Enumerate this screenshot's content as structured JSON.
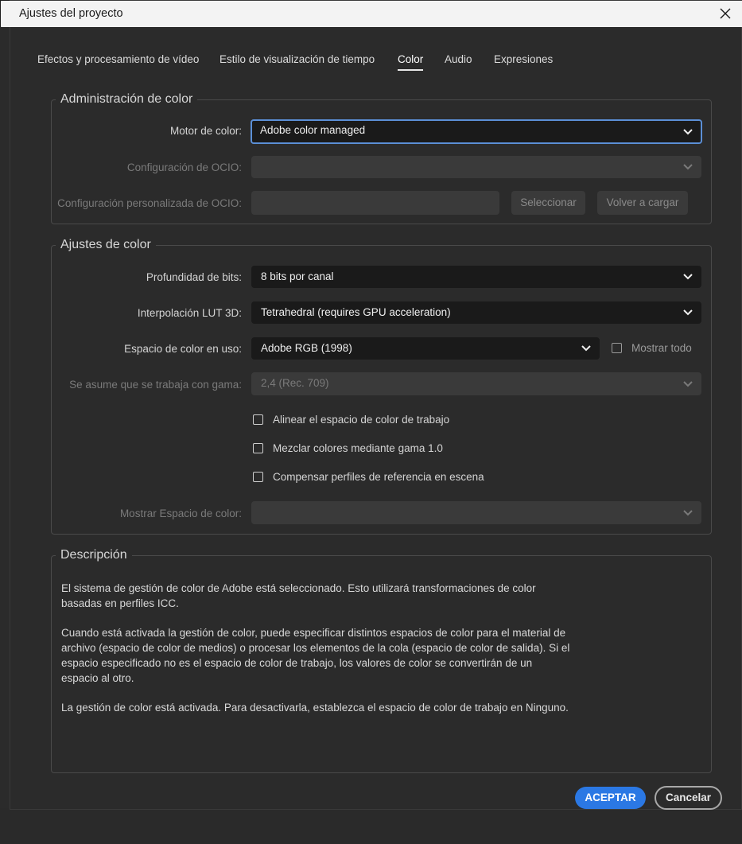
{
  "window": {
    "title": "Ajustes del proyecto",
    "close_icon": "close-icon"
  },
  "tabs": [
    {
      "label": "Efectos y procesamiento de vídeo",
      "active": false
    },
    {
      "label": "Estilo de visualización de tiempo",
      "active": false
    },
    {
      "label": "Color",
      "active": true
    },
    {
      "label": "Audio",
      "active": false
    },
    {
      "label": "Expresiones",
      "active": false
    }
  ],
  "color_management": {
    "legend": "Administración de color",
    "engine_label": "Motor de color:",
    "engine_value": "Adobe color managed",
    "ocio_config_label": "Configuración de OCIO:",
    "ocio_config_value": "",
    "ocio_custom_label": "Configuración personalizada de OCIO:",
    "select_button": "Seleccionar",
    "reload_button": "Volver a cargar"
  },
  "color_settings": {
    "legend": "Ajustes de color",
    "bit_depth_label": "Profundidad de bits:",
    "bit_depth_value": "8 bits por canal",
    "lut_label": "Interpolación LUT 3D:",
    "lut_value": "Tetrahedral (requires GPU acceleration)",
    "working_space_label": "Espacio de color en uso:",
    "working_space_value": "Adobe RGB (1998)",
    "show_all_label": "Mostrar todo",
    "gamma_label": "Se asume que se trabaja con gama:",
    "gamma_value": "2,4 (Rec. 709)",
    "align_label": "Alinear el espacio de color de trabajo",
    "blend_label": "Mezclar colores mediante gama 1.0",
    "compensate_label": "Compensar perfiles de referencia en escena",
    "display_space_label": "Mostrar Espacio de color:",
    "display_space_value": ""
  },
  "description": {
    "legend": "Descripción",
    "p1": "El sistema de gestión de color de Adobe está seleccionado. Esto utilizará transformaciones de color basadas en perfiles ICC.",
    "p2": "Cuando está activada la gestión de color, puede especificar distintos espacios de color para el material de archivo (espacio de color de medios) o procesar los elementos de la cola (espacio de color de salida). Si el espacio especificado no es el espacio de color de trabajo, los valores de color se convertirán de un espacio al otro.",
    "p3": "La gestión de color está activada. Para desactivarla, establezca el espacio de color de trabajo en Ninguno."
  },
  "footer": {
    "ok_button": "ACEPTAR",
    "cancel_button": "Cancelar"
  },
  "colors": {
    "accent": "#2b78e4",
    "focus_ring": "#5b8fd6",
    "dialog_bg": "#2b2b2b",
    "field_bg": "#1a1a1a"
  }
}
